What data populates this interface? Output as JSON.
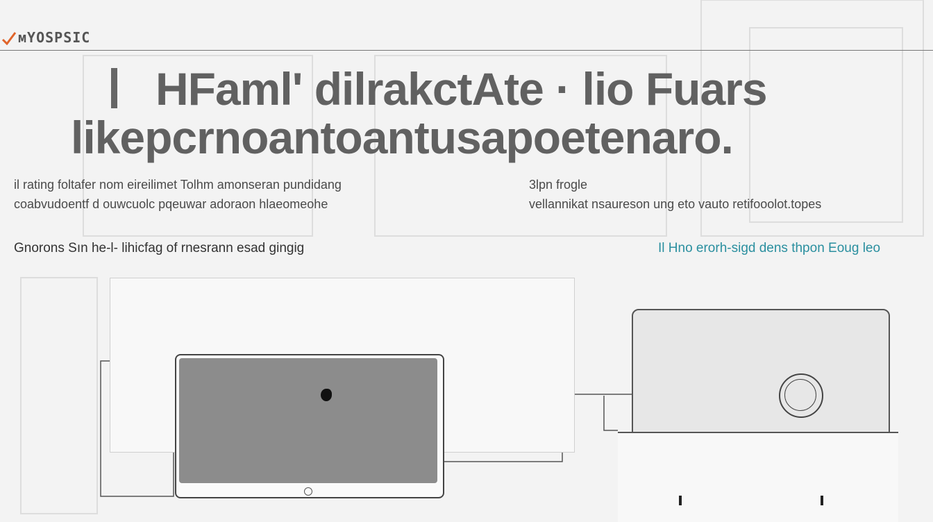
{
  "header": {
    "brand": "мYOSPSIC",
    "title_line1": "HFaml' dilrakctAte · lio Fuars",
    "title_line2": "likepcrnoantoantusapoetenaro."
  },
  "columns": {
    "left_line1": "il rating foltafer nom eireilimet    Tolhm    amonseran pundidang",
    "left_line2": "coabvudoentf d ouwcuolc pqeuwar adoraon hlaeomeohe",
    "right_title": "3lpn frogle",
    "right_line1": "vellannikat nsaureson ung eto    vauto retifooolot.topes"
  },
  "sub_left": "Gnorons Sın he‑l‑ lihicfag of rnesrann esad gingig",
  "sub_right_prefix": "Il Hno erorh‑sigd",
  "sub_right_accent": "dens thpon Eoug leo",
  "colors": {
    "accent": "#2a8f9f",
    "logo_mark": "#e0642a",
    "text": "#4a4a4a"
  },
  "icons": {
    "logo": "check-mark-icon",
    "tablet_home": "home-button-icon",
    "knob": "dial-icon"
  }
}
